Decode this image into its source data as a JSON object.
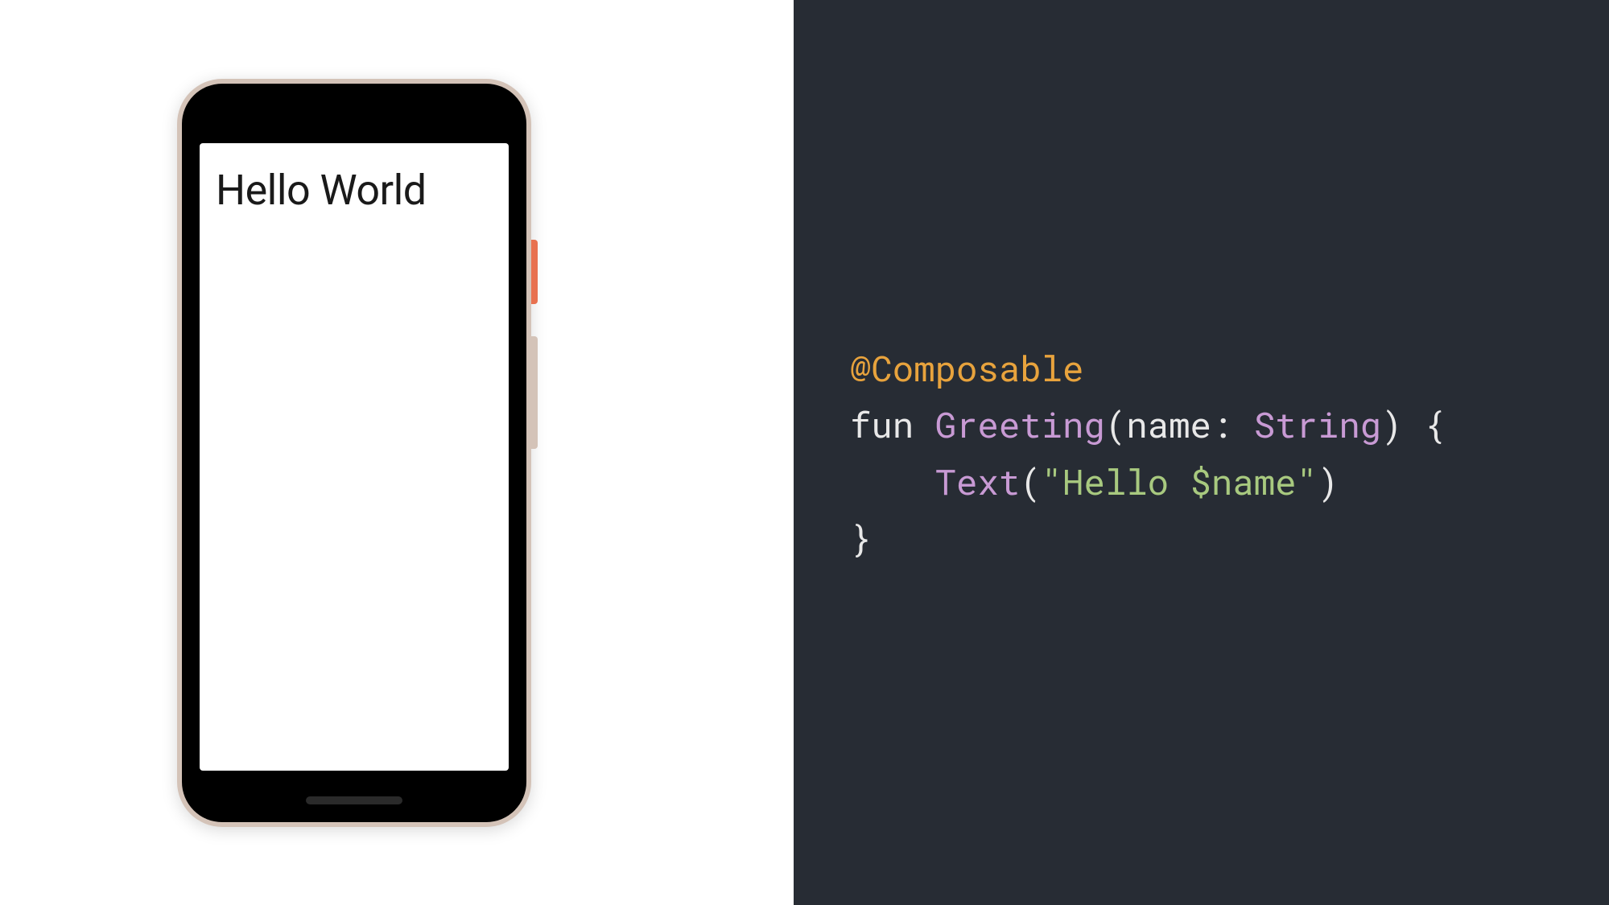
{
  "phone": {
    "screen_text": "Hello World"
  },
  "code": {
    "annotation": "@Composable",
    "keyword_fun": "fun",
    "function_name": "Greeting",
    "paren_open": "(",
    "param_name": "name",
    "colon": ":",
    "space": " ",
    "param_type": "String",
    "paren_close": ")",
    "brace_open": "{",
    "indent": "    ",
    "text_call": "Text",
    "call_open": "(",
    "string_value": "\"Hello $name\"",
    "call_close": ")",
    "brace_close": "}"
  }
}
